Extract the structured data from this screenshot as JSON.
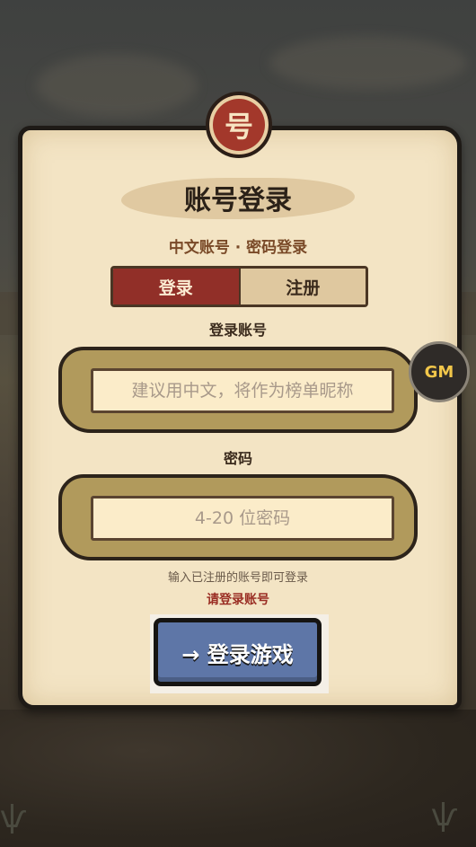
{
  "badge": {
    "glyph": "号"
  },
  "header": {
    "title": "账号登录",
    "subtitle": "中文账号 · 密码登录"
  },
  "tabs": [
    {
      "label": "登录",
      "active": true
    },
    {
      "label": "注册",
      "active": false
    }
  ],
  "account": {
    "label": "登录账号",
    "placeholder": "建议用中文，将作为榜单昵称",
    "value": ""
  },
  "password": {
    "label": "密码",
    "placeholder": "4-20 位密码",
    "value": ""
  },
  "hint": "输入已注册的账号即可登录",
  "error": "请登录账号",
  "submit": {
    "label": "→ 登录游戏"
  },
  "gm_button": {
    "label": "GM"
  },
  "colors": {
    "panel": "#f3e4c4",
    "accent_red": "#912f28",
    "button_blue": "#5e76a7",
    "gm_text": "#f1c64a"
  }
}
